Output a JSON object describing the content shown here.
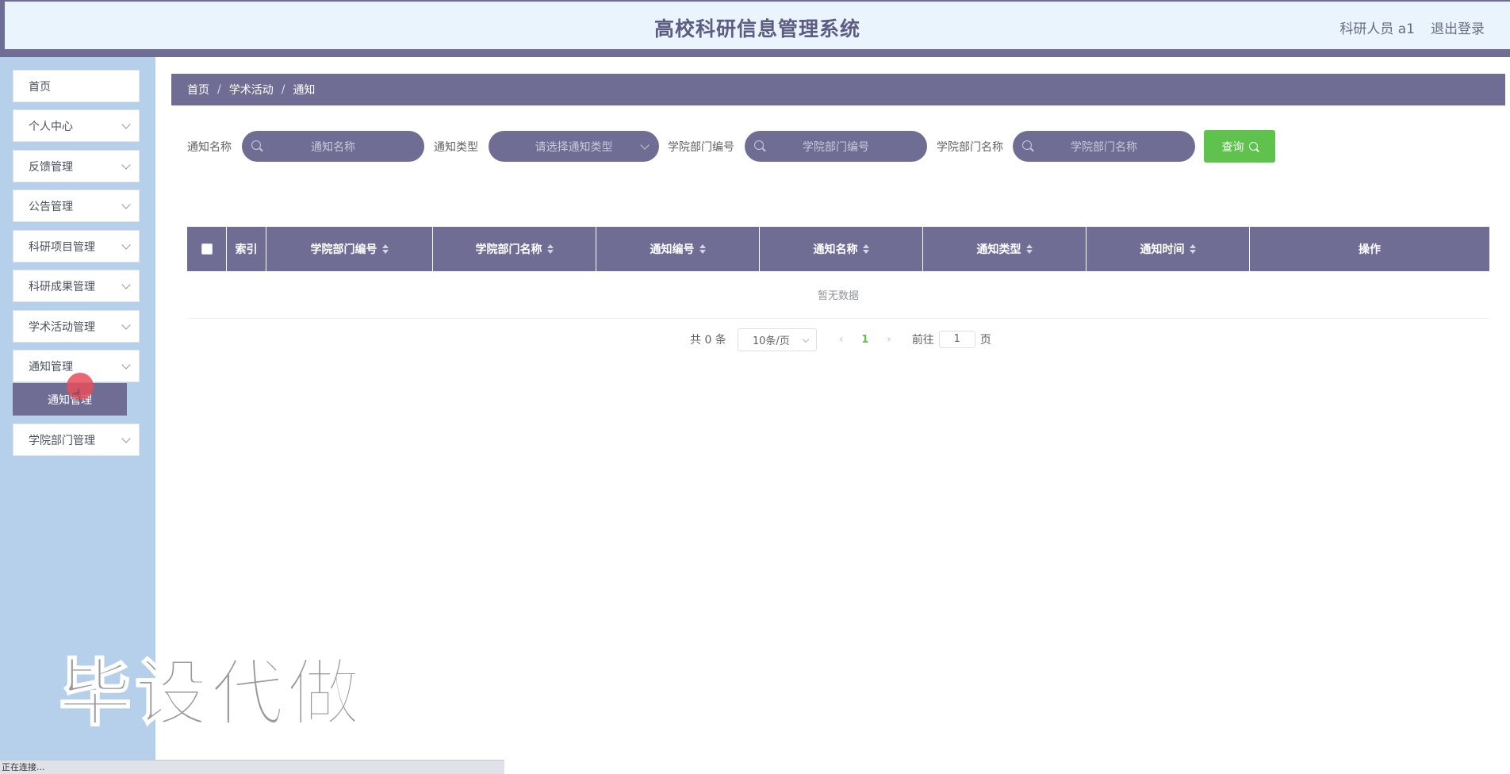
{
  "header": {
    "title": "高校科研信息管理系统",
    "user_label": "科研人员 a1",
    "logout_label": "退出登录"
  },
  "sidebar": {
    "items": [
      {
        "label": "首页",
        "has_chevron": false
      },
      {
        "label": "个人中心",
        "has_chevron": true
      },
      {
        "label": "反馈管理",
        "has_chevron": true
      },
      {
        "label": "公告管理",
        "has_chevron": true
      },
      {
        "label": "科研项目管理",
        "has_chevron": true
      },
      {
        "label": "科研成果管理",
        "has_chevron": true
      },
      {
        "label": "学术活动管理",
        "has_chevron": true
      },
      {
        "label": "通知管理",
        "has_chevron": true,
        "expanded": true
      },
      {
        "label": "学院部门管理",
        "has_chevron": true
      }
    ],
    "active_subitem": "通知管理"
  },
  "breadcrumb": [
    "首页",
    "学术活动",
    "通知"
  ],
  "search": {
    "fields": [
      {
        "label": "通知名称",
        "placeholder": "通知名称",
        "type": "input"
      },
      {
        "label": "通知类型",
        "placeholder": "请选择通知类型",
        "type": "select"
      },
      {
        "label": "学院部门编号",
        "placeholder": "学院部门编号",
        "type": "input"
      },
      {
        "label": "学院部门名称",
        "placeholder": "学院部门名称",
        "type": "input"
      }
    ],
    "query_button": "查询"
  },
  "table": {
    "columns": [
      {
        "label": "",
        "checkbox": true
      },
      {
        "label": "索引",
        "sortable": false
      },
      {
        "label": "学院部门编号",
        "sortable": true
      },
      {
        "label": "学院部门名称",
        "sortable": true
      },
      {
        "label": "通知编号",
        "sortable": true
      },
      {
        "label": "通知名称",
        "sortable": true
      },
      {
        "label": "通知类型",
        "sortable": true
      },
      {
        "label": "通知时间",
        "sortable": true
      },
      {
        "label": "操作",
        "sortable": false
      }
    ],
    "rows": [],
    "empty_text": "暂无数据"
  },
  "pagination": {
    "total_text": "共 0 条",
    "page_size": "10条/页",
    "prev_icon": "‹",
    "next_icon": "›",
    "current_page": "1",
    "goto_prefix": "前往",
    "goto_value": "1",
    "goto_suffix": "页"
  },
  "watermark": "毕设代做",
  "statusbar": "正在连接..."
}
